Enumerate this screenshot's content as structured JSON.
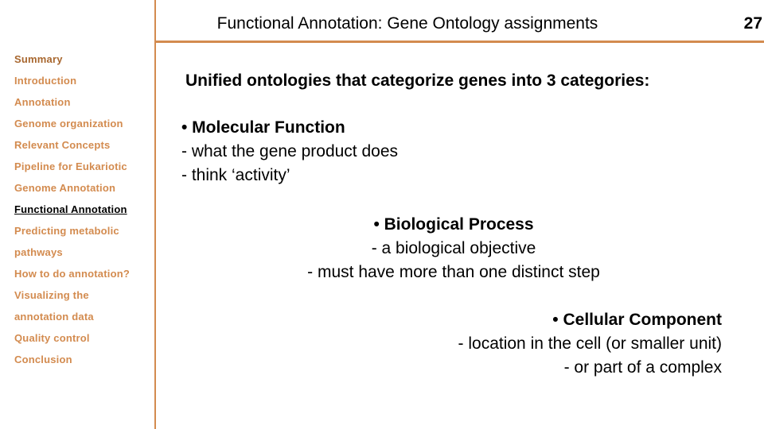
{
  "slide": {
    "title": "Functional Annotation: Gene Ontology assignments",
    "page_number": "27",
    "accent_color": "#d38b4f"
  },
  "sidebar": {
    "items": [
      {
        "label": "Summary",
        "state": "section"
      },
      {
        "label": "Introduction",
        "state": "link"
      },
      {
        "label": "Annotation",
        "state": "link"
      },
      {
        "label": "Genome organization",
        "state": "link"
      },
      {
        "label": "Relevant Concepts",
        "state": "link"
      },
      {
        "label": "Pipeline for Eukariotic",
        "state": "link"
      },
      {
        "label": "Genome Annotation",
        "state": "link"
      },
      {
        "label": "Functional Annotation",
        "state": "current"
      },
      {
        "label": "Predicting metabolic",
        "state": "link"
      },
      {
        "label": "pathways",
        "state": "link"
      },
      {
        "label": "How to do annotation?",
        "state": "link"
      },
      {
        "label": "Visualizing the",
        "state": "link"
      },
      {
        "label": "annotation data",
        "state": "link"
      },
      {
        "label": "Quality control",
        "state": "link"
      },
      {
        "label": "Conclusion",
        "state": "link"
      }
    ]
  },
  "content": {
    "intro": "Unified ontologies that categorize genes into 3 categories:",
    "categories": [
      {
        "heading": "• Molecular Function",
        "lines": [
          "- what the gene product does",
          "- think ‘activity’"
        ]
      },
      {
        "heading": "• Biological Process",
        "lines": [
          "- a biological objective",
          "- must have more than one distinct step"
        ]
      },
      {
        "heading": "• Cellular Component",
        "lines": [
          "- location in the cell (or smaller unit)",
          "- or part of a complex"
        ]
      }
    ]
  }
}
